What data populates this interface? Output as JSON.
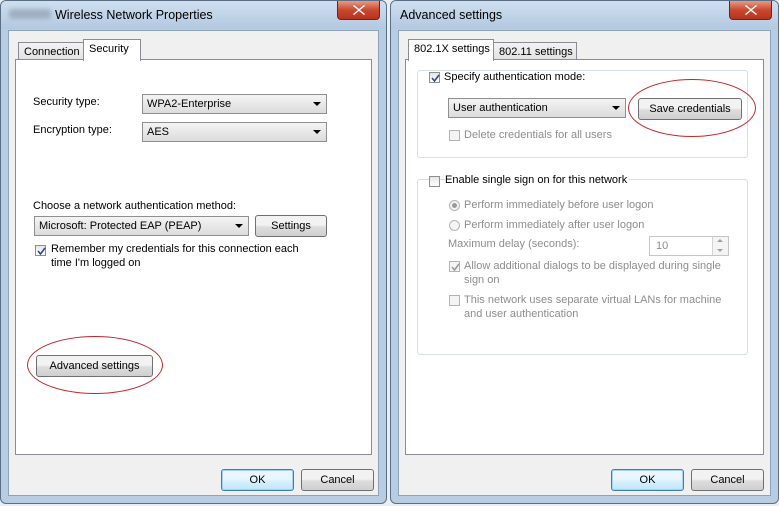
{
  "left_window": {
    "title": "Wireless Network Properties",
    "tabs": [
      {
        "label": "Connection"
      },
      {
        "label": "Security"
      }
    ],
    "security_type_label": "Security type:",
    "security_type_value": "WPA2-Enterprise",
    "encryption_type_label": "Encryption type:",
    "encryption_type_value": "AES",
    "auth_method_label": "Choose a network authentication method:",
    "auth_method_value": "Microsoft: Protected EAP (PEAP)",
    "settings_button": "Settings",
    "remember_label_line1": "Remember my credentials for this connection each",
    "remember_label_line2": "time I'm logged on",
    "remember_checked": true,
    "advanced_button": "Advanced settings",
    "ok_button": "OK",
    "cancel_button": "Cancel"
  },
  "right_window": {
    "title": "Advanced settings",
    "tabs": [
      {
        "label": "802.1X settings"
      },
      {
        "label": "802.11 settings"
      }
    ],
    "specify_auth_label": "Specify authentication mode:",
    "specify_auth_checked": true,
    "auth_mode_value": "User authentication",
    "save_credentials_button": "Save credentials",
    "delete_credentials_label": "Delete credentials for all users",
    "sso_label": "Enable single sign on for this network",
    "before_logon_label": "Perform immediately before user logon",
    "after_logon_label": "Perform immediately after user logon",
    "max_delay_label": "Maximum delay (seconds):",
    "max_delay_value": "10",
    "allow_dialogs_line1": "Allow additional dialogs to be displayed during single",
    "allow_dialogs_line2": "sign on",
    "separate_vlans_line1": "This network uses separate virtual LANs for machine",
    "separate_vlans_line2": "and user authentication",
    "ok_button": "OK",
    "cancel_button": "Cancel"
  },
  "colors": {
    "highlight_ellipse": "#c3262e",
    "close_button": "#c9482f",
    "title_bar": "#c2d6ea"
  }
}
